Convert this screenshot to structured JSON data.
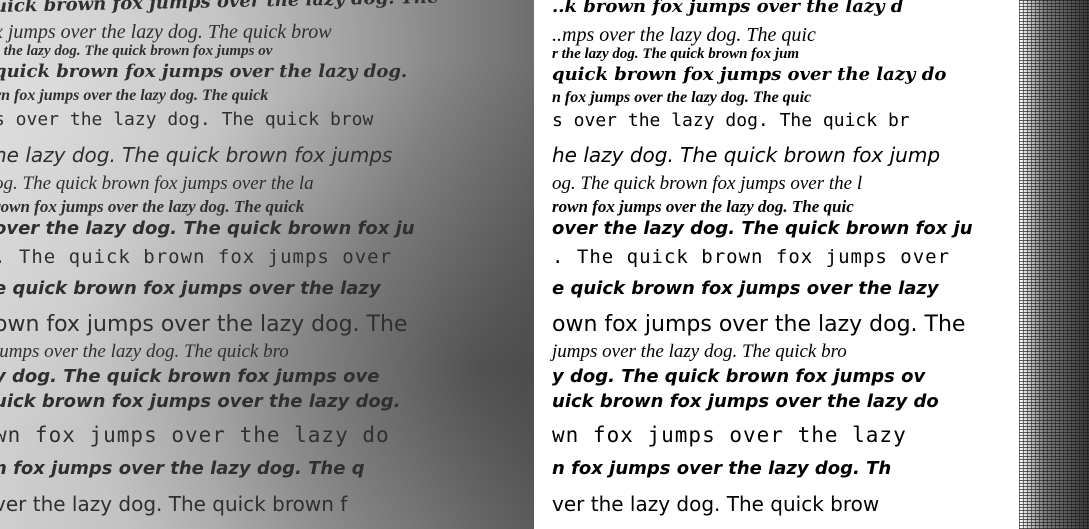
{
  "left_panel": {
    "lines": [
      "uick brown fox jumps over the lazy dog. The",
      "x jumps over the lazy dog. The quick brow",
      "r the lazy dog. The quick brown fox jumps ov",
      "quick brown fox jumps over the lazy dog.",
      "vn fox jumps over the lazy dog. The quick",
      "s over the lazy dog. The quick brow",
      "he lazy dog. The quick brown fox jumps",
      "og. The quick brown fox jumps over the la",
      "rown fox jumps over the lazy dog. The quick",
      "over the lazy dog. The quick brown fox ju",
      ". The quick brown fox jumps over",
      "e quick brown fox jumps over the lazy",
      "own fox jumps over the lazy dog. The",
      "jumps over the lazy dog. The quick bro",
      "y dog. The quick brown fox jumps ove",
      "uick brown fox jumps over the lazy dog.",
      "wn fox jumps over the lazy do",
      "n fox jumps over the lazy dog. The q",
      "ver the lazy dog. The quick brown f"
    ]
  },
  "right_panel": {
    "lines": [
      "..k brown fox jumps over the lazy d",
      "..mps over the lazy dog. The quic",
      "r the lazy dog. The quick brown fox jum",
      "quick brown fox jumps over the lazy do",
      "n fox jumps over the lazy dog. The quic",
      "s over the lazy dog. The quick br",
      "he lazy dog. The quick brown fox jump",
      "og. The quick brown fox jumps over the l",
      "rown fox jumps over the lazy dog. The quic",
      "over the lazy dog. The quick brown fox ju",
      ". The quick brown fox jumps over",
      "e quick brown fox jumps over the lazy",
      "own fox jumps over the lazy dog. The",
      "jumps over the lazy dog. The quick bro",
      "y dog. The quick brown fox jumps ov",
      "uick brown fox jumps over the lazy do",
      "wn fox jumps over the lazy",
      "n fox jumps over the lazy dog. Th",
      "ver the lazy dog. The quick brow"
    ]
  }
}
